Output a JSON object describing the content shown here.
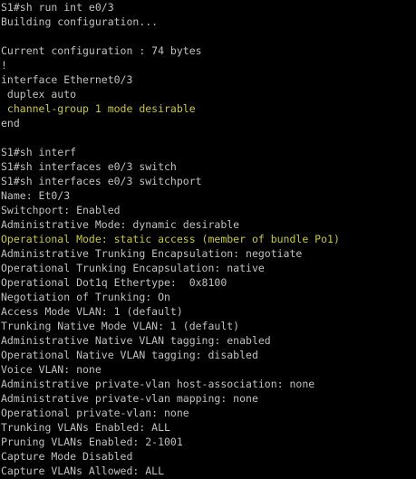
{
  "terminal": {
    "colors": {
      "background": "#000000",
      "default_text": "#c0c0c0",
      "highlight_text": "#c8c832"
    },
    "lines": [
      {
        "text": "S1#sh run int e0/3",
        "highlight": false
      },
      {
        "text": "Building configuration...",
        "highlight": false
      },
      {
        "text": "",
        "highlight": false
      },
      {
        "text": "Current configuration : 74 bytes",
        "highlight": false
      },
      {
        "text": "!",
        "highlight": false
      },
      {
        "text": "interface Ethernet0/3",
        "highlight": false
      },
      {
        "text": " duplex auto",
        "highlight": false
      },
      {
        "text": " channel-group 1 mode desirable",
        "highlight": true
      },
      {
        "text": "end",
        "highlight": false
      },
      {
        "text": "",
        "highlight": false
      },
      {
        "text": "S1#sh interf",
        "highlight": false
      },
      {
        "text": "S1#sh interfaces e0/3 switch",
        "highlight": false
      },
      {
        "text": "S1#sh interfaces e0/3 switchport",
        "highlight": false
      },
      {
        "text": "Name: Et0/3",
        "highlight": false
      },
      {
        "text": "Switchport: Enabled",
        "highlight": false
      },
      {
        "text": "Administrative Mode: dynamic desirable",
        "highlight": false
      },
      {
        "text": "Operational Mode: static access (member of bundle Po1)",
        "highlight": true
      },
      {
        "text": "Administrative Trunking Encapsulation: negotiate",
        "highlight": false
      },
      {
        "text": "Operational Trunking Encapsulation: native",
        "highlight": false
      },
      {
        "text": "Operational Dot1q Ethertype:  0x8100",
        "highlight": false
      },
      {
        "text": "Negotiation of Trunking: On",
        "highlight": false
      },
      {
        "text": "Access Mode VLAN: 1 (default)",
        "highlight": false
      },
      {
        "text": "Trunking Native Mode VLAN: 1 (default)",
        "highlight": false
      },
      {
        "text": "Administrative Native VLAN tagging: enabled",
        "highlight": false
      },
      {
        "text": "Operational Native VLAN tagging: disabled",
        "highlight": false
      },
      {
        "text": "Voice VLAN: none",
        "highlight": false
      },
      {
        "text": "Administrative private-vlan host-association: none",
        "highlight": false
      },
      {
        "text": "Administrative private-vlan mapping: none",
        "highlight": false
      },
      {
        "text": "Operational private-vlan: none",
        "highlight": false
      },
      {
        "text": "Trunking VLANs Enabled: ALL",
        "highlight": false
      },
      {
        "text": "Pruning VLANs Enabled: 2-1001",
        "highlight": false
      },
      {
        "text": "Capture Mode Disabled",
        "highlight": false
      },
      {
        "text": "Capture VLANs Allowed: ALL",
        "highlight": false
      }
    ]
  }
}
